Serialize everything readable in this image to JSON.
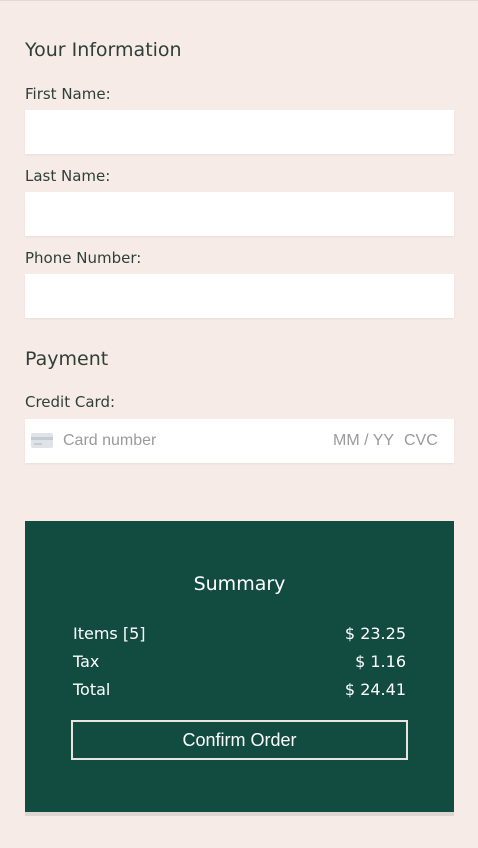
{
  "info": {
    "title": "Your Information",
    "first_name_label": "First Name:",
    "last_name_label": "Last Name:",
    "phone_label": "Phone Number:"
  },
  "payment": {
    "title": "Payment",
    "card_label": "Credit Card:",
    "card_number_placeholder": "Card number",
    "expiry_placeholder": "MM / YY",
    "cvc_placeholder": "CVC",
    "card_icon": "credit-card-icon"
  },
  "summary": {
    "title": "Summary",
    "items": [
      {
        "label": "Items [5]",
        "value": "$ 23.25"
      },
      {
        "label": "Tax",
        "value": "$ 1.16"
      },
      {
        "label": "Total",
        "value": "$ 24.41"
      }
    ],
    "confirm_label": "Confirm Order"
  },
  "colors": {
    "background": "#f6ebe6",
    "summary_bg": "#124c41",
    "text": "#2f3f38"
  }
}
